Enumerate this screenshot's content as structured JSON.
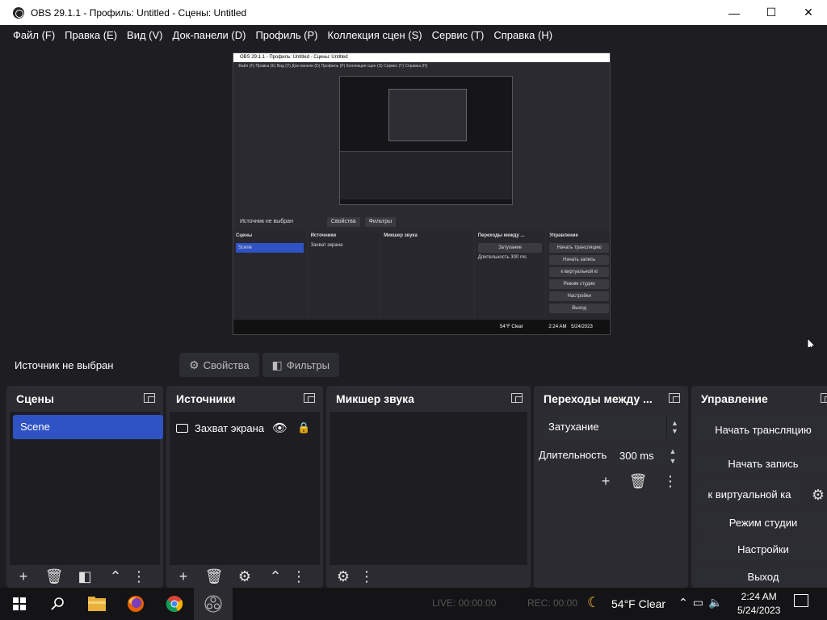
{
  "window": {
    "title": "OBS 29.1.1 - Профиль: Untitled - Сцены: Untitled",
    "minimize": "—",
    "maximize": "☐",
    "close": "✕"
  },
  "menu": [
    "Файл (F)",
    "Правка (E)",
    "Вид (V)",
    "Док-панели (D)",
    "Профиль (P)",
    "Коллекция сцен (S)",
    "Сервис (T)",
    "Справка (H)"
  ],
  "preview": {
    "title": "OBS 29.1.1 - Профиль: Untitled - Сцены: Untitled",
    "menu": "Файл (F)  Правка (E)  Вид (V)  Док-панели (D)  Профиль (P)  Коллекция сцен (S)  Сервис (T)  Справка (H)",
    "no_source": "Источник не выбран",
    "properties": "Свойства",
    "filters": "Фильтры",
    "docks": {
      "scenes": "Сцены",
      "sources": "Источники",
      "mixer": "Микшер звука",
      "transitions": "Переходы между ...",
      "controls": "Управление"
    },
    "scene_item": "Scene",
    "source_item": "Захват экрана",
    "fade": "Затухание",
    "duration_label": "Длительность",
    "duration_value": "300 ms",
    "btn_stream": "Начать трансляцию",
    "btn_record": "Начать запись",
    "btn_virtual": "к виртуальной кі",
    "btn_studio": "Режим студии",
    "btn_settings": "Настройки",
    "btn_exit": "Выход",
    "weather": "54°F  Clear",
    "time": "2:24 AM",
    "date": "5/24/2023"
  },
  "source_bar": {
    "no_source": "Источник не выбран",
    "properties": "Свойства",
    "filters": "Фильтры"
  },
  "docks": {
    "scenes": {
      "title": "Сцены",
      "items": [
        "Scene"
      ]
    },
    "sources": {
      "title": "Источники",
      "items": [
        "Захват экрана"
      ]
    },
    "mixer": {
      "title": "Микшер звука"
    },
    "transitions": {
      "title": "Переходы между ...",
      "transition": "Затухание",
      "duration_label": "Длительность",
      "duration_value": "300 ms"
    },
    "controls": {
      "title": "Управление",
      "start_stream": "Начать трансляцию",
      "start_record": "Начать запись",
      "virtual_cam": "к виртуальной ка",
      "studio_mode": "Режим студии",
      "settings": "Настройки",
      "exit": "Выход"
    }
  },
  "taskbar": {
    "live": "LIVE: 00:00:00",
    "rec": "REC: 00:00",
    "weather": "54°F  Clear",
    "time": "2:24 AM",
    "date": "5/24/2023"
  }
}
